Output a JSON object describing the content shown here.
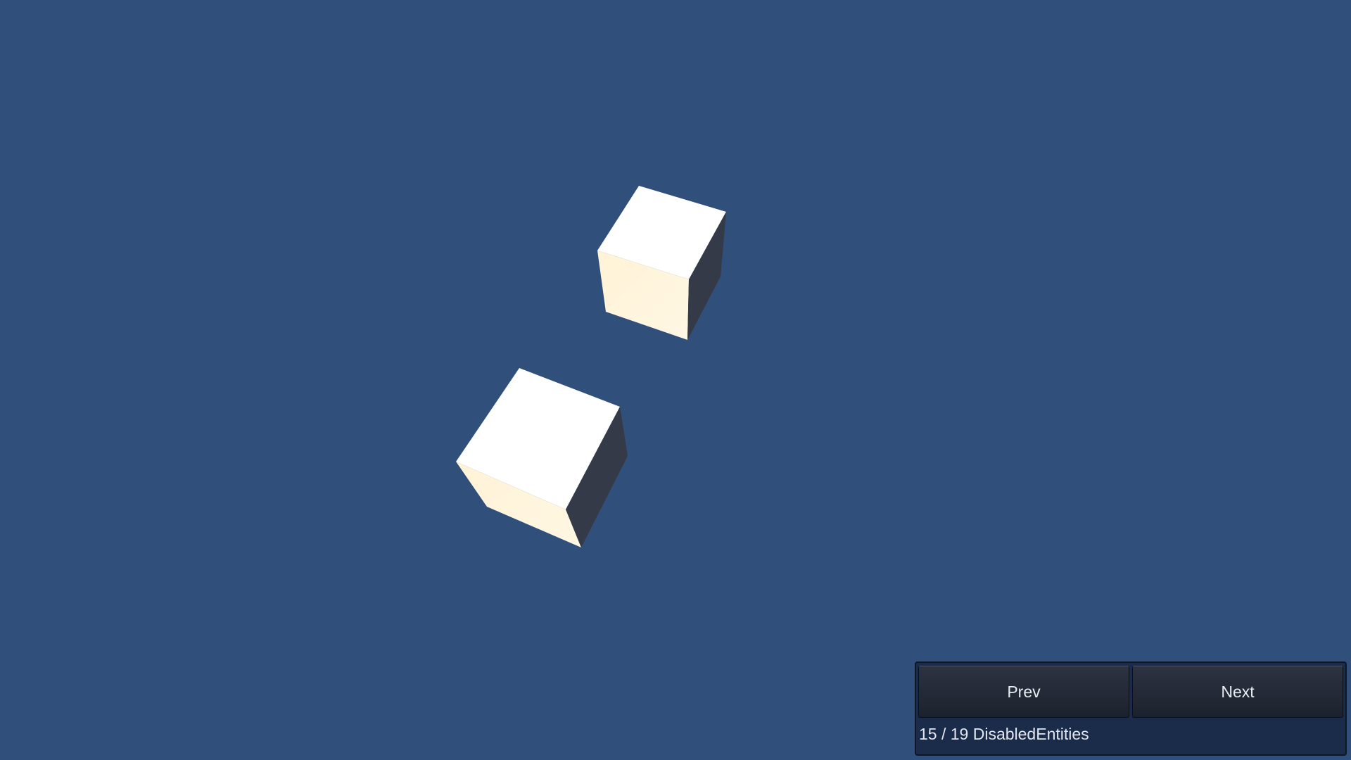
{
  "scene": {
    "background_color": "#314f7b",
    "objects": [
      "cube",
      "cube"
    ],
    "cube_colors": {
      "top": "#ffffff",
      "front": "#fff5dc",
      "side": "#343a47"
    }
  },
  "navigation": {
    "prev_label": "Prev",
    "next_label": "Next",
    "status_text": "15 / 19 DisabledEntities",
    "current_index": 15,
    "total": 19
  }
}
